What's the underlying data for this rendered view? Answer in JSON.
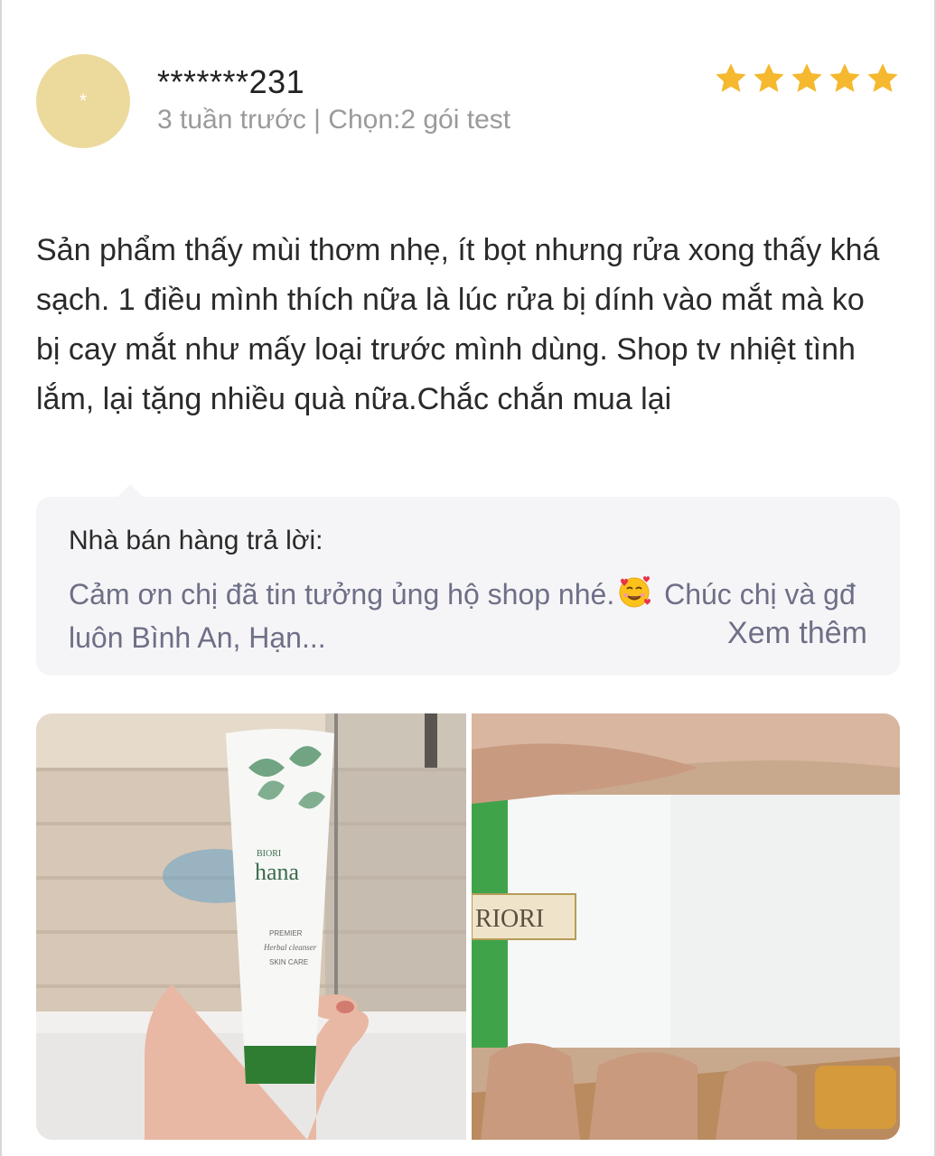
{
  "review": {
    "avatar_initial": "*",
    "username": "*******231",
    "meta": "3 tuần trước | Chọn:2 gói test",
    "rating": 5,
    "star_icon": "star-icon",
    "star_color": "#f5b82e",
    "text": "Sản phẩm thấy mùi thơm nhẹ, ít bọt nhưng rửa xong thấy khá sạch. 1 điều mình thích nữa là lúc rửa bị dính vào mắt mà ko bị cay mắt như mấy loại trước mình dùng. Shop tv nhiệt tình lắm, lại tặng nhiều quà nữa.Chắc chắn mua lại"
  },
  "seller_reply": {
    "title": "Nhà bán hàng trả lời:",
    "text_before_emoji": "Cảm ơn chị đã tin tưởng ủng hộ shop nhé.",
    "emoji_icon": "smiling-face-with-hearts-icon",
    "text_after_emoji": " Chúc chị và gđ luôn Bình An, Hạn...",
    "see_more_label": "Xem thêm"
  },
  "photos": {
    "photo_1": {
      "tube_brand_small": "BIORI",
      "tube_brand": "hana",
      "tube_line1": "PREMIER",
      "tube_line2": "Herbal cleanser",
      "tube_line3": "SKIN CARE"
    },
    "photo_2": {
      "label_text": "RIORI"
    }
  },
  "colors": {
    "avatar_bg": "#ecd99c",
    "meta_text": "#9a9a9a",
    "reply_bg": "#f5f5f7",
    "reply_text": "#6e6f87"
  }
}
